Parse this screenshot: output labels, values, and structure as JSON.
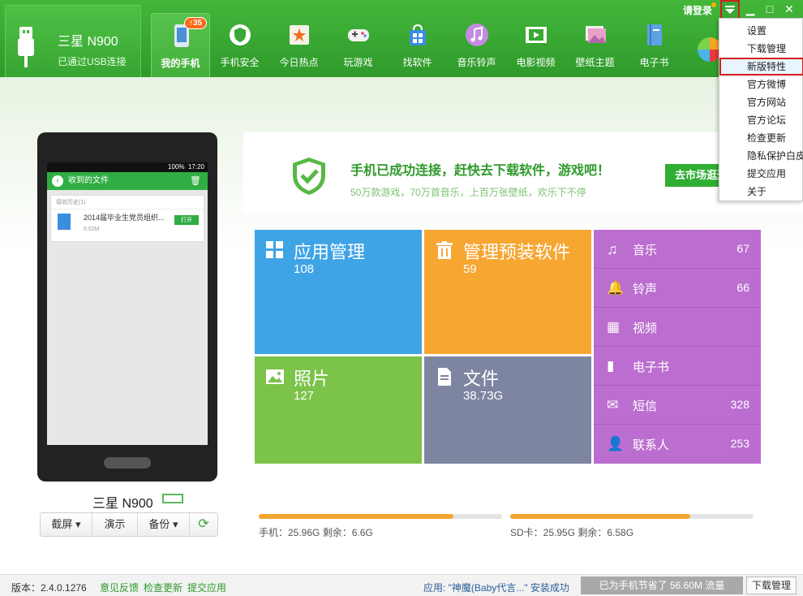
{
  "device": {
    "name": "三星 N900",
    "status": "已通过USB连接"
  },
  "nav": [
    {
      "label": "我的手机",
      "icon": "phone-icon",
      "badge": "35",
      "active": true
    },
    {
      "label": "手机安全",
      "icon": "shield-nav-icon"
    },
    {
      "label": "今日热点",
      "icon": "star-icon"
    },
    {
      "label": "玩游戏",
      "icon": "gamepad-icon"
    },
    {
      "label": "找软件",
      "icon": "store-bag-icon"
    },
    {
      "label": "音乐铃声",
      "icon": "music-note-icon"
    },
    {
      "label": "电影视频",
      "icon": "film-icon"
    },
    {
      "label": "壁纸主题",
      "icon": "wallpaper-icon"
    },
    {
      "label": "电子书",
      "icon": "book-icon"
    }
  ],
  "titlebar": {
    "login": "请登录"
  },
  "menu": [
    {
      "label": "设置"
    },
    {
      "label": "下载管理"
    },
    {
      "label": "新版特性",
      "highlighted": true
    },
    {
      "label": "官方微博"
    },
    {
      "label": "官方网站"
    },
    {
      "label": "官方论坛"
    },
    {
      "label": "检查更新"
    },
    {
      "label": "隐私保护白皮"
    },
    {
      "label": "提交应用"
    },
    {
      "label": "关于"
    }
  ],
  "phone_screen": {
    "time": "17:20",
    "battery": "100%",
    "title": "收到的文件",
    "history": "接收历史(1)",
    "file_name": "2014届毕业生党员组织...",
    "file_size": "0.02M",
    "open": "打开"
  },
  "phone_label": "三星 N900",
  "phone_actions": [
    "截屏 ▾",
    "演示",
    "备份 ▾",
    "⟳"
  ],
  "banner": {
    "title": "手机已成功连接，赶快去下载软件，游戏吧！",
    "subtitle": "50万款游戏，70万首音乐，上百万张壁纸，欢乐下不停",
    "button": "去市场逛逛"
  },
  "tiles": {
    "apps": {
      "title": "应用管理",
      "count": "108"
    },
    "preinstalled": {
      "title": "管理预装软件",
      "count": "59"
    },
    "photos": {
      "title": "照片",
      "count": "127"
    },
    "files": {
      "title": "文件",
      "count": "38.73G"
    }
  },
  "media": [
    {
      "label": "音乐",
      "count": "67",
      "icon": "music-icon"
    },
    {
      "label": "铃声",
      "count": "66",
      "icon": "bell-icon"
    },
    {
      "label": "视频",
      "count": "",
      "icon": "video-icon"
    },
    {
      "label": "电子书",
      "count": "",
      "icon": "ebook-icon"
    },
    {
      "label": "短信",
      "count": "328",
      "icon": "mail-icon"
    },
    {
      "label": "联系人",
      "count": "253",
      "icon": "contact-icon"
    }
  ],
  "storage": {
    "phone": {
      "text": "手机：25.96G   剩余：6.6G",
      "used_fraction": 0.8
    },
    "sd": {
      "text": "SD卡：25.95G   剩余：6.58G",
      "used_fraction": 0.74
    }
  },
  "footer": {
    "version": "版本：2.4.0.1276",
    "feedback": "意见反馈",
    "check_update": "检查更新",
    "submit_app": "提交应用",
    "install_status": "应用: \"神魔(Baby代言...\" 安装成功",
    "saved": "已为手机节省了 56.60M 流量",
    "download_mgr": "下载管理"
  }
}
